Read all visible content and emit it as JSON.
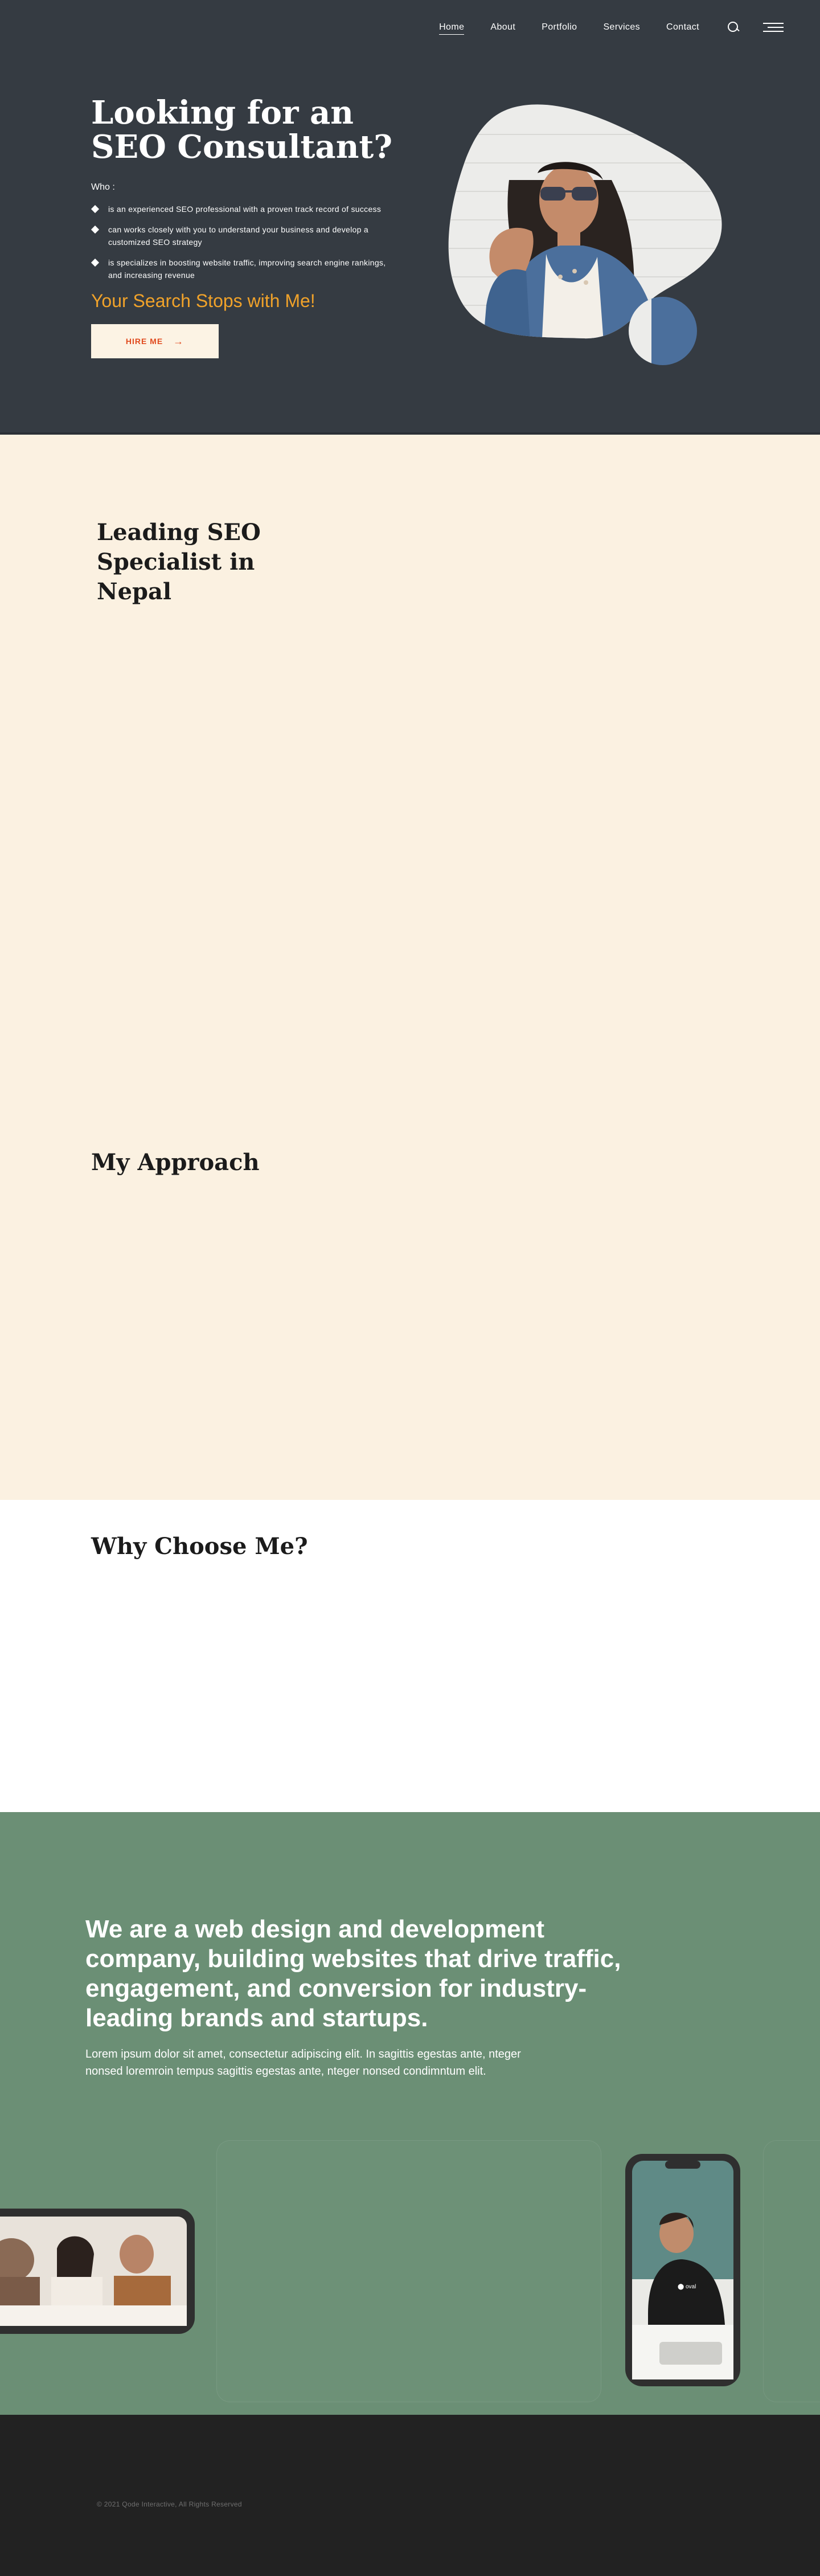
{
  "nav": {
    "items": [
      {
        "label": "Home",
        "active": true
      },
      {
        "label": "About"
      },
      {
        "label": "Portfolio"
      },
      {
        "label": "Services"
      },
      {
        "label": "Contact"
      }
    ],
    "icons": [
      "search-icon",
      "menu-icon"
    ]
  },
  "hero": {
    "title": "Looking for an SEO Consultant?",
    "who": "Who :",
    "bullets": [
      "is an experienced SEO professional with a proven track record of success",
      "can works closely with you to understand your business and develop a customized SEO strategy",
      "is specializes in boosting website traffic, improving search engine rankings, and increasing revenue"
    ],
    "tagline": "Your Search Stops with Me!",
    "cta_label": "HIRE ME",
    "cta_arrow": "→"
  },
  "cream": {
    "lead_title": "Leading SEO Specialist in Nepal",
    "approach_title": "My Approach"
  },
  "why": {
    "title": "Why Choose Me?"
  },
  "company": {
    "heading": "We are a web design and development company, building websites that drive traffic, engagement, and conversion for industry-leading brands and startups.",
    "text": "Lorem ipsum dolor sit amet, consectetur adipiscing elit. In sagittis egestas ante, nteger nonsed loremroin tempus sagittis egestas ante, nteger nonsed condimntum elit."
  },
  "footer": {
    "copyright": "© 2021 Qode Interactive, All Rights Reserved"
  },
  "colors": {
    "hero_bg": "#353b42",
    "accent": "#f0a22a",
    "cta_bg": "#fcf3e4",
    "cta_text": "#e04a1e",
    "cream_bg": "#fbf1e1",
    "green_bg": "#6b8f75",
    "footer_bg": "#222222"
  }
}
